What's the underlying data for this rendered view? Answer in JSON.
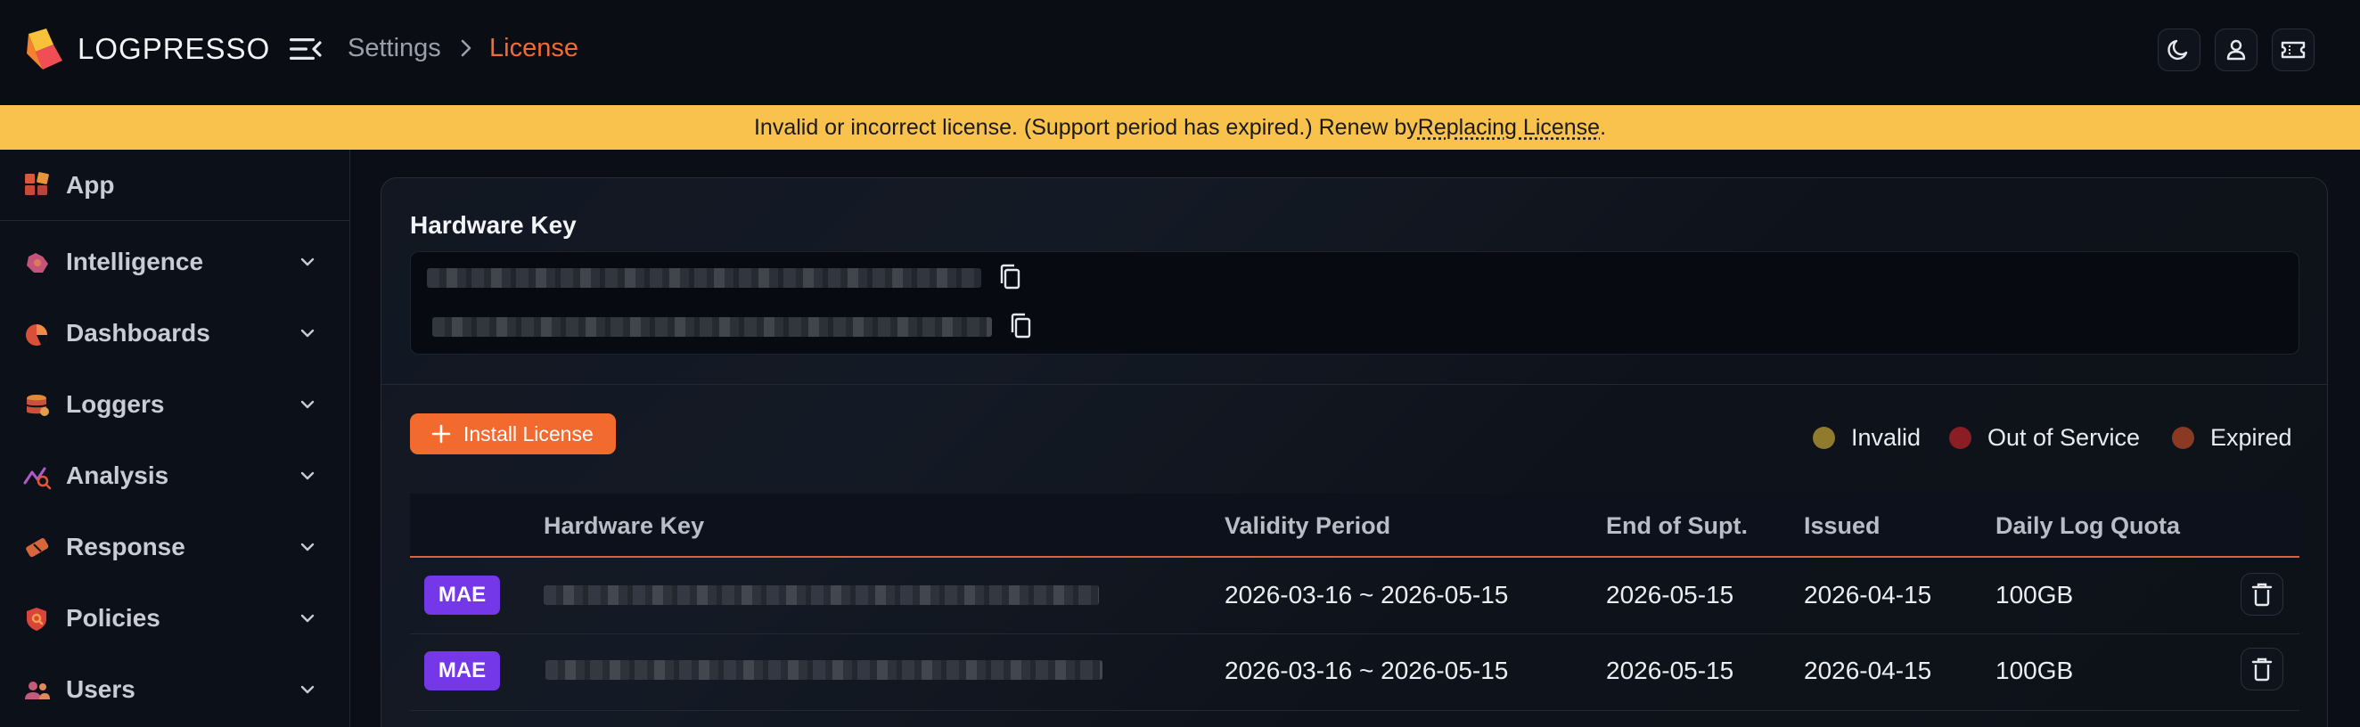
{
  "header": {
    "brand": "LOGPRESSO",
    "breadcrumb": {
      "parent": "Settings",
      "current": "License"
    },
    "buttons": [
      {
        "icon": "moon-icon"
      },
      {
        "icon": "user-icon"
      },
      {
        "icon": "ticket-icon"
      }
    ]
  },
  "banner": {
    "text": "Invalid or incorrect license. (Support period has expired.) Renew by",
    "link": "Replacing License",
    "suffix": "."
  },
  "sidebar": {
    "app_label": "App",
    "items": [
      {
        "label": "Intelligence",
        "icon": "intelligence-icon"
      },
      {
        "label": "Dashboards",
        "icon": "pie-chart-icon"
      },
      {
        "label": "Loggers",
        "icon": "database-icon"
      },
      {
        "label": "Analysis",
        "icon": "analysis-icon"
      },
      {
        "label": "Response",
        "icon": "response-icon"
      },
      {
        "label": "Policies",
        "icon": "shield-icon"
      },
      {
        "label": "Users",
        "icon": "users-icon"
      }
    ]
  },
  "hardware_key": {
    "title": "Hardware Key"
  },
  "toolbar": {
    "install_label": "Install License"
  },
  "legend": [
    {
      "label": "Invalid",
      "color": "#8f7a2e"
    },
    {
      "label": "Out of Service",
      "color": "#8b1e24"
    },
    {
      "label": "Expired",
      "color": "#8a3a22"
    }
  ],
  "table": {
    "columns": [
      "Hardware Key",
      "Validity Period",
      "End of Supt.",
      "Issued",
      "Daily Log Quota"
    ],
    "rows": [
      {
        "badge": "MAE",
        "validity": "2026-03-16 ~ 2026-05-15",
        "end_of_support": "2026-05-15",
        "issued": "2026-04-15",
        "quota": "100GB"
      },
      {
        "badge": "MAE",
        "validity": "2026-03-16 ~ 2026-05-15",
        "end_of_support": "2026-05-15",
        "issued": "2026-04-15",
        "quota": "100GB"
      }
    ]
  },
  "colors": {
    "accent": "#f26a2e",
    "banner": "#f8c24d",
    "badge": "#7438e8"
  }
}
